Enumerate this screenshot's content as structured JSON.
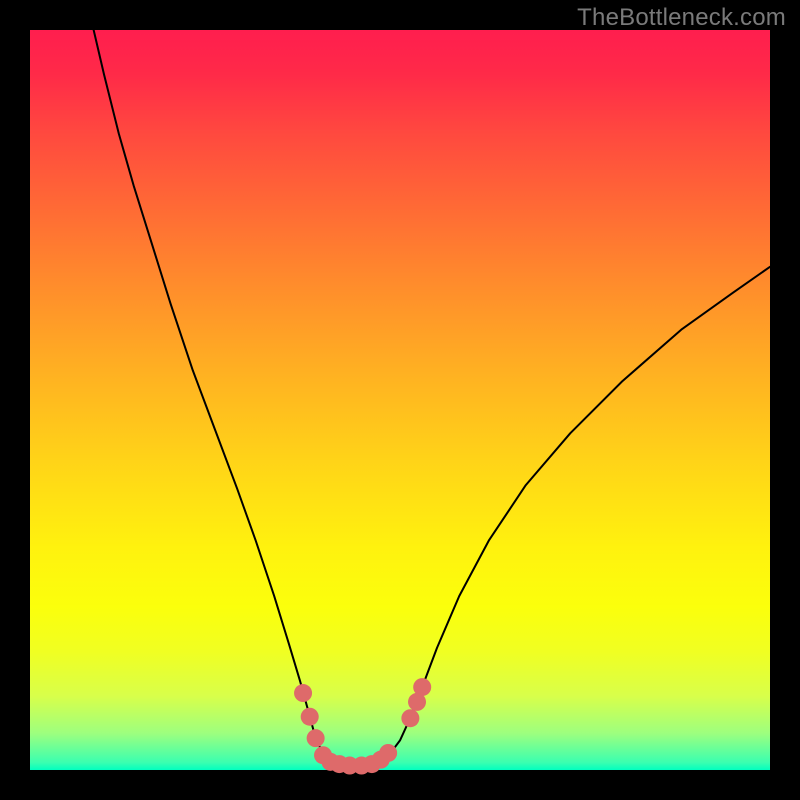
{
  "watermark": "TheBottleneck.com",
  "chart_data": {
    "type": "line",
    "title": "",
    "subtitle": "",
    "xlabel": "",
    "ylabel": "",
    "xlim": [
      0,
      100
    ],
    "ylim": [
      0,
      100
    ],
    "grid": false,
    "legend": false,
    "notes": "Heat-gradient background (red=bad, green=good) with a U/V-shaped bottleneck curve. Black curve marks bottleneck severity vs x; salmon markers highlight approximate curve samples near the minimum on each side. Values are read from pixel positions; axes are unlabeled in the source image.",
    "curve_black": [
      {
        "x": 8.6,
        "y": 100.0
      },
      {
        "x": 10.0,
        "y": 94.0
      },
      {
        "x": 12.0,
        "y": 86.0
      },
      {
        "x": 14.0,
        "y": 79.0
      },
      {
        "x": 16.5,
        "y": 71.0
      },
      {
        "x": 19.0,
        "y": 63.0
      },
      {
        "x": 22.0,
        "y": 54.0
      },
      {
        "x": 25.0,
        "y": 46.0
      },
      {
        "x": 28.0,
        "y": 38.0
      },
      {
        "x": 30.5,
        "y": 31.0
      },
      {
        "x": 33.0,
        "y": 23.5
      },
      {
        "x": 35.0,
        "y": 17.0
      },
      {
        "x": 36.5,
        "y": 12.0
      },
      {
        "x": 37.6,
        "y": 8.0
      },
      {
        "x": 38.6,
        "y": 4.3
      },
      {
        "x": 39.8,
        "y": 1.8
      },
      {
        "x": 41.5,
        "y": 0.8
      },
      {
        "x": 43.0,
        "y": 0.6
      },
      {
        "x": 45.0,
        "y": 0.6
      },
      {
        "x": 47.0,
        "y": 1.0
      },
      {
        "x": 48.5,
        "y": 2.0
      },
      {
        "x": 50.0,
        "y": 4.0
      },
      {
        "x": 51.6,
        "y": 7.5
      },
      {
        "x": 53.0,
        "y": 11.2
      },
      {
        "x": 55.0,
        "y": 16.5
      },
      {
        "x": 58.0,
        "y": 23.5
      },
      {
        "x": 62.0,
        "y": 31.0
      },
      {
        "x": 67.0,
        "y": 38.5
      },
      {
        "x": 73.0,
        "y": 45.5
      },
      {
        "x": 80.0,
        "y": 52.5
      },
      {
        "x": 88.0,
        "y": 59.5
      },
      {
        "x": 95.0,
        "y": 64.5
      },
      {
        "x": 100.0,
        "y": 68.0
      }
    ],
    "markers_salmon": [
      {
        "x": 36.9,
        "y": 10.4
      },
      {
        "x": 37.8,
        "y": 7.2
      },
      {
        "x": 38.6,
        "y": 4.3
      },
      {
        "x": 39.6,
        "y": 2.0
      },
      {
        "x": 40.6,
        "y": 1.1
      },
      {
        "x": 41.8,
        "y": 0.8
      },
      {
        "x": 43.2,
        "y": 0.6
      },
      {
        "x": 44.8,
        "y": 0.6
      },
      {
        "x": 46.2,
        "y": 0.8
      },
      {
        "x": 47.4,
        "y": 1.4
      },
      {
        "x": 48.4,
        "y": 2.3
      },
      {
        "x": 51.4,
        "y": 7.0
      },
      {
        "x": 52.3,
        "y": 9.2
      },
      {
        "x": 53.0,
        "y": 11.2
      }
    ],
    "colors": {
      "curve": "#000000",
      "marker": "#de6a6a",
      "gradient_top": "#ff1e4e",
      "gradient_bottom": "#00ffc0"
    },
    "marker_radius": 9,
    "curve_stroke_width": 2
  }
}
